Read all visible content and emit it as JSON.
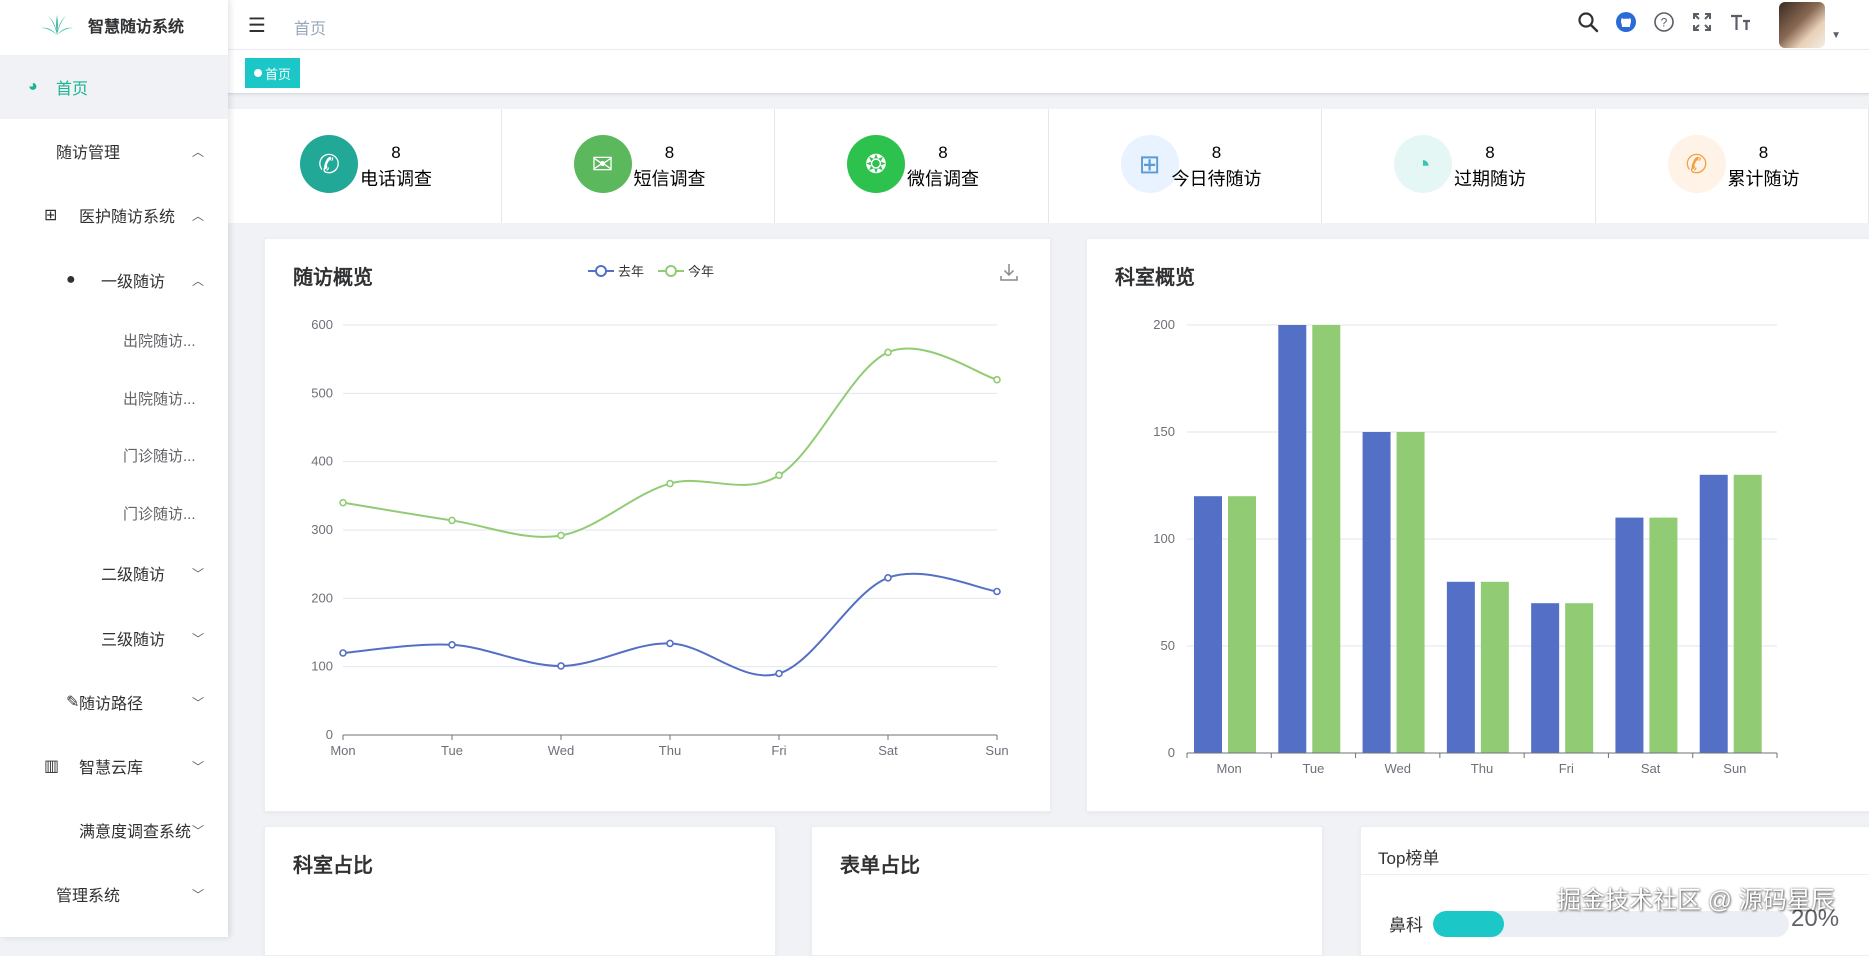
{
  "app": {
    "title": "智慧随访系统"
  },
  "sidebar": {
    "items": [
      {
        "label": "首页",
        "icon": "dashboard-icon",
        "active": true
      },
      {
        "label": "随访管理",
        "chevron": "up"
      },
      {
        "label": "医护随访系统",
        "icon": "table-icon",
        "chevron": "up"
      },
      {
        "label": "一级随访",
        "icon": "user-icon",
        "chevron": "up"
      },
      {
        "label": "出院随访..."
      },
      {
        "label": "出院随访..."
      },
      {
        "label": "门诊随访..."
      },
      {
        "label": "门诊随访..."
      },
      {
        "label": "二级随访",
        "chevron": "down"
      },
      {
        "label": "三级随访",
        "chevron": "down"
      },
      {
        "label": "随访路径",
        "icon": "edit-icon",
        "chevron": "down"
      },
      {
        "label": "智慧云库",
        "icon": "book-icon",
        "chevron": "down"
      },
      {
        "label": "满意度调查系统",
        "chevron": "down"
      },
      {
        "label": "管理系统",
        "chevron": "down"
      }
    ]
  },
  "header": {
    "breadcrumb": "首页",
    "icons": [
      "search-icon",
      "github-icon",
      "help-icon",
      "fullscreen-icon",
      "font-size-icon"
    ]
  },
  "tags": {
    "active": "首页"
  },
  "stats": [
    {
      "value": "8",
      "label": "电话调查",
      "icon": "phone-icon",
      "color": "#22a896",
      "glyph": "✆"
    },
    {
      "value": "8",
      "label": "短信调查",
      "icon": "mail-icon",
      "color": "#5cb85c",
      "glyph": "✉"
    },
    {
      "value": "8",
      "label": "微信调查",
      "icon": "wechat-icon",
      "color": "#2dc24e",
      "glyph": "❂"
    },
    {
      "value": "8",
      "label": "今日待随访",
      "icon": "chat-plus-icon",
      "color": "#e8f3ff",
      "glyph": "⊞",
      "glyph_color": "#5b9bd5"
    },
    {
      "value": "8",
      "label": "过期随访",
      "icon": "clock-icon",
      "color": "#e5f7f5",
      "glyph": "◔",
      "glyph_color": "#3cc4b0"
    },
    {
      "value": "8",
      "label": "累计随访",
      "icon": "whatsapp-icon",
      "color": "#fff2e6",
      "glyph": "✆",
      "glyph_color": "#f0a040"
    }
  ],
  "visit_overview": {
    "title": "随访概览",
    "legend": [
      "去年",
      "今年"
    ],
    "colors": [
      "#5470c6",
      "#91cc75"
    ]
  },
  "dept_overview": {
    "title": "科室概览"
  },
  "dept_ratio": {
    "title": "科室占比"
  },
  "form_ratio": {
    "title": "表单占比"
  },
  "top_list": {
    "title": "Top榜单",
    "items": [
      {
        "name": "鼻科",
        "percent": 20,
        "percent_label": "20%"
      }
    ]
  },
  "watermark": "掘金技术社区 @ 源码星辰",
  "chart_data": [
    {
      "type": "line",
      "categories": [
        "Mon",
        "Tue",
        "Wed",
        "Thu",
        "Fri",
        "Sat",
        "Sun"
      ],
      "series": [
        {
          "name": "去年",
          "values": [
            120,
            132,
            101,
            134,
            90,
            230,
            210
          ]
        },
        {
          "name": "今年",
          "values": [
            340,
            314,
            292,
            368,
            380,
            560,
            520
          ]
        }
      ],
      "ylim": [
        0,
        600
      ],
      "yticks": [
        0,
        100,
        200,
        300,
        400,
        500,
        600
      ],
      "grid": true
    },
    {
      "type": "bar",
      "categories": [
        "Mon",
        "Tue",
        "Wed",
        "Thu",
        "Fri",
        "Sat",
        "Sun"
      ],
      "series": [
        {
          "values": [
            120,
            200,
            150,
            80,
            70,
            110,
            130
          ]
        },
        {
          "values": [
            120,
            200,
            150,
            80,
            70,
            110,
            130
          ]
        }
      ],
      "ylim": [
        0,
        200
      ],
      "yticks": [
        0,
        50,
        100,
        150,
        200
      ],
      "grid": true
    }
  ]
}
